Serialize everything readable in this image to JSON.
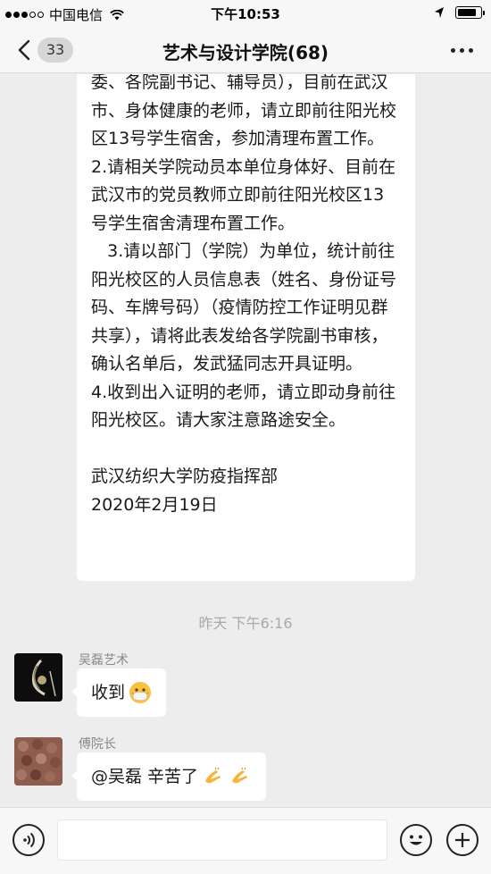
{
  "status_bar": {
    "carrier": "中国电信",
    "time": "下午10:53",
    "battery_level": 0.85,
    "icons": [
      "signal-icon",
      "wifi-icon",
      "location-arrow-icon",
      "battery-icon"
    ]
  },
  "nav": {
    "back_icon": "chevron-left-icon",
    "unread_count": "33",
    "title": "艺术与设计学院(68)",
    "more_icon": "more-dots-icon"
  },
  "messages": {
    "notice_text": "委、各院副书记、辅导员），目前在武汉市、身体健康的老师，请立即前往阳光校区13号学生宿舍，参加清理布置工作。\n2.请相关学院动员本单位身体好、目前在武汉市的党员教师立即前往阳光校区13号学生宿舍清理布置工作。\n   3.请以部门（学院）为单位，统计前往阳光校区的人员信息表（姓名、身份证号码、车牌号码）（疫情防控工作证明见群共享），请将此表发给各学院副书审核，确认名单后，发武猛同志开具证明。\n4.收到出入证明的老师，请立即动身前往阳光校区。请大家注意路途安全。\n\n武汉纺织大学防疫指挥部\n2020年2月19日",
    "time_separator": "昨天 下午6:16",
    "items": [
      {
        "sender": "吴磊艺术",
        "text": "收到",
        "emoji": "mask-face-emoji"
      },
      {
        "sender": "傅院长",
        "text": "@吴磊 辛苦了",
        "emoji": "clapping-hands-emoji"
      }
    ]
  },
  "input_bar": {
    "voice_icon": "voice-icon",
    "emoji_icon": "smiley-icon",
    "plus_icon": "plus-icon",
    "placeholder": ""
  },
  "colors": {
    "background": "#ededed",
    "bubble": "#ffffff",
    "bar": "#f7f7f7",
    "timestamp": "#a9a9a9",
    "sender": "#888888"
  }
}
